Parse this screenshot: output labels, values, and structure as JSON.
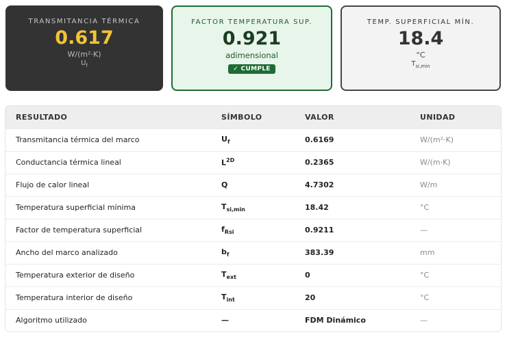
{
  "cards": [
    {
      "title": "TRANSMITANCIA TÉRMICA",
      "value": "0.617",
      "unit": "W/(m²·K)",
      "sym_base": "U",
      "sym_sub": "f"
    },
    {
      "title": "FACTOR TEMPERATURA SUP.",
      "value": "0.921",
      "unit": "adimensional",
      "badge": "✓ CUMPLE"
    },
    {
      "title": "TEMP. SUPERFICIAL MÍN.",
      "value": "18.4",
      "unit": "°C",
      "sym_base": "T",
      "sym_sub": "si,min"
    }
  ],
  "table": {
    "headers": [
      "RESULTADO",
      "SÍMBOLO",
      "VALOR",
      "UNIDAD"
    ],
    "rows": [
      {
        "label": "Transmitancia térmica del marco",
        "sym": "U",
        "sub": "f",
        "sup": "",
        "value": "0.6169",
        "unit": "W/(m²·K)"
      },
      {
        "label": "Conductancia térmica lineal",
        "sym": "L",
        "sub": "",
        "sup": "2D",
        "value": "0.2365",
        "unit": "W/(m·K)"
      },
      {
        "label": "Flujo de calor lineal",
        "sym": "Q",
        "sub": "",
        "sup": "",
        "value": "4.7302",
        "unit": "W/m"
      },
      {
        "label": "Temperatura superficial mínima",
        "sym": "T",
        "sub": "si,min",
        "sup": "",
        "value": "18.42",
        "unit": "°C"
      },
      {
        "label": "Factor de temperatura superficial",
        "sym": "f",
        "sub": "Rsi",
        "sup": "",
        "value": "0.9211",
        "unit": "—"
      },
      {
        "label": "Ancho del marco analizado",
        "sym": "b",
        "sub": "f",
        "sup": "",
        "value": "383.39",
        "unit": "mm"
      },
      {
        "label": "Temperatura exterior de diseño",
        "sym": "T",
        "sub": "ext",
        "sup": "",
        "value": "0",
        "unit": "°C"
      },
      {
        "label": "Temperatura interior de diseño",
        "sym": "T",
        "sub": "int",
        "sup": "",
        "value": "20",
        "unit": "°C"
      },
      {
        "label": "Algoritmo utilizado",
        "sym": "—",
        "sub": "",
        "sup": "",
        "value": "FDM Dinámico",
        "unit": "—"
      }
    ]
  }
}
